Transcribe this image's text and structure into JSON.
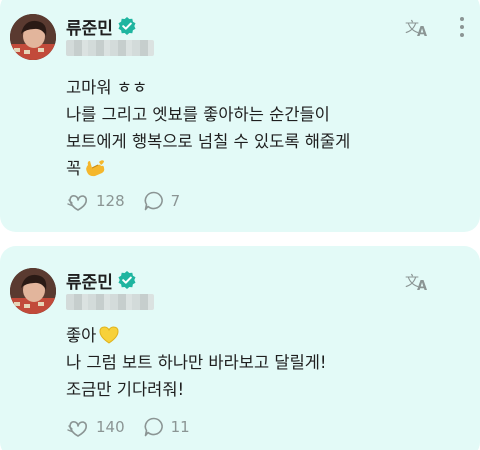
{
  "posts": [
    {
      "author": "류준민",
      "verified_color": "#1fb5a0",
      "body_lines": [
        "고마워 ㅎㅎ",
        "나를 그리고 엣뵤를 좋아하는 순간들이",
        "보트에게 행복으로 넘칠 수 있도록 해줄게",
        "꼭"
      ],
      "emoji": "call-me-hand-emoji",
      "likes": "128",
      "comments": "7"
    },
    {
      "author": "류준민",
      "verified_color": "#1fb5a0",
      "body_lines": [
        "좋아",
        "나 그럼 보트 하나만 바라보고 달릴게!",
        "조금만 기다려줘!"
      ],
      "emoji": "yellow-heart-emoji",
      "likes": "140",
      "comments": "11"
    }
  ],
  "icons": {
    "translate": "translate-icon",
    "more": "more-vertical-icon",
    "like": "heart-hands-icon",
    "comment": "speech-bubble-icon"
  },
  "colors": {
    "card_background": "#e3faf7",
    "icon_gray": "#8b9594"
  }
}
